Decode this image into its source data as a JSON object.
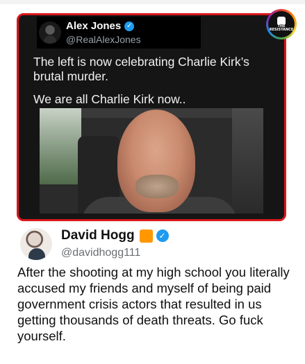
{
  "quoted_tweet": {
    "author_name": "Alex Jones",
    "handle": "@RealAlexJones",
    "text_lines": [
      "The left is now celebrating Charlie Kirk’s brutal murder.",
      "We are all Charlie Kirk now.."
    ],
    "verified_icon": "verified-check-icon"
  },
  "logo": {
    "text": "THE RESISTANCE"
  },
  "main_tweet": {
    "author_name": "David Hogg",
    "handle": "@davidhogg111",
    "text": "After the shooting at my high school you literally accused my friends and myself of being paid government crisis actors that resulted in us getting thousands of death threats. Go fuck yourself.",
    "verified_icon": "verified-check-icon",
    "badge_icon": "orange-square-icon"
  },
  "colors": {
    "frame_border": "#d9161c",
    "card_bg": "#151515",
    "verified_blue": "#1d9bf0",
    "orange_badge": "#ff9800"
  }
}
